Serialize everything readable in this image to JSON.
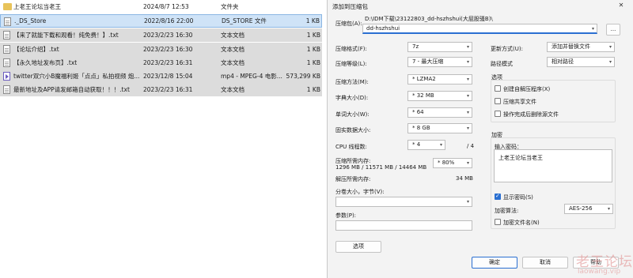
{
  "files": [
    {
      "name": "上老王论坛当老王",
      "date": "2024/8/7 12:53",
      "type": "文件夹",
      "size": "",
      "icon": "folder-icon"
    },
    {
      "name": "._DS_Store",
      "date": "2022/8/16 22:00",
      "type": "DS_STORE 文件",
      "size": "1 KB",
      "icon": "document-icon"
    },
    {
      "name": "【来了就能下载和观看！纯免费！】.txt",
      "date": "2023/2/23 16:30",
      "type": "文本文档",
      "size": "1 KB",
      "icon": "document-icon"
    },
    {
      "name": "【论坛介绍】.txt",
      "date": "2023/2/23 16:30",
      "type": "文本文档",
      "size": "1 KB",
      "icon": "document-icon"
    },
    {
      "name": "【永久地址发布页】.txt",
      "date": "2023/2/23 16:31",
      "type": "文本文档",
      "size": "1 KB",
      "icon": "document-icon"
    },
    {
      "name": "twitter双穴小B魔福利姬「点点」私拍视频 炮...",
      "date": "2023/12/8 15:04",
      "type": "mp4 - MPEG-4 电影...",
      "size": "573,299 KB",
      "icon": "video-icon"
    },
    {
      "name": "最新地址及APP请发邮箱自动获取！！！.txt",
      "date": "2023/2/23 16:31",
      "type": "文本文档",
      "size": "1 KB",
      "icon": "document-icon"
    }
  ],
  "dialog": {
    "title": "添加到压缩包",
    "close_glyph": "✕",
    "archive_label": "压缩包(A):",
    "archive_path": "D:\\IDM下载\\23122803_dd-hszhshui(大屁股骚B)\\",
    "archive_name": "dd-hszhshui",
    "browse_label": "...",
    "format_label": "压缩格式(F):",
    "format_value": "7z",
    "level_label": "压缩等级(L):",
    "level_value": "7 - 最大压缩",
    "method_label": "压缩方法(M):",
    "method_value": "* LZMA2",
    "dict_label": "字典大小(D):",
    "dict_value": "* 32 MB",
    "word_label": "单词大小(W):",
    "word_value": "* 64",
    "solid_label": "固实数据大小:",
    "solid_value": "* 8 GB",
    "threads_label": "CPU 线程数:",
    "threads_value": "* 4",
    "threads_total": "/ 4",
    "mem_label": "压缩所需内存:",
    "mem_values": "1296 MB / 11571 MB / 14464 MB",
    "mem_percent": "* 80%",
    "decomp_label": "解压所需内存:",
    "decomp_value": "34 MB",
    "split_label": "分卷大小，字节(V):",
    "split_value": "",
    "params_label": "参数(P):",
    "params_value": "",
    "options_button": "选项",
    "update_label": "更新方式(U):",
    "update_value": "添加并替换文件",
    "path_label": "路径模式",
    "path_value": "相对路径",
    "options_group": "选项",
    "opt_sfx": "创建自解压程序(X)",
    "opt_shared": "压缩共享文件",
    "opt_delete": "操作完成后删除源文件",
    "encrypt_group": "加密",
    "password_label": "输入密码：",
    "password_value": "上老王论坛当老王",
    "show_password": "显示密码(S)",
    "enc_method_label": "加密算法:",
    "enc_method_value": "AES-256",
    "enc_names": "加密文件名(N)",
    "ok_button": "确定",
    "cancel_button": "取消",
    "help_button": "帮助"
  },
  "watermark": {
    "line1": "老王论坛",
    "line2": "laowang.vip"
  },
  "colors": {
    "accent": "#2a6fd1",
    "row_gray": "#dcdcdc",
    "selection": "#cfe3f7"
  }
}
